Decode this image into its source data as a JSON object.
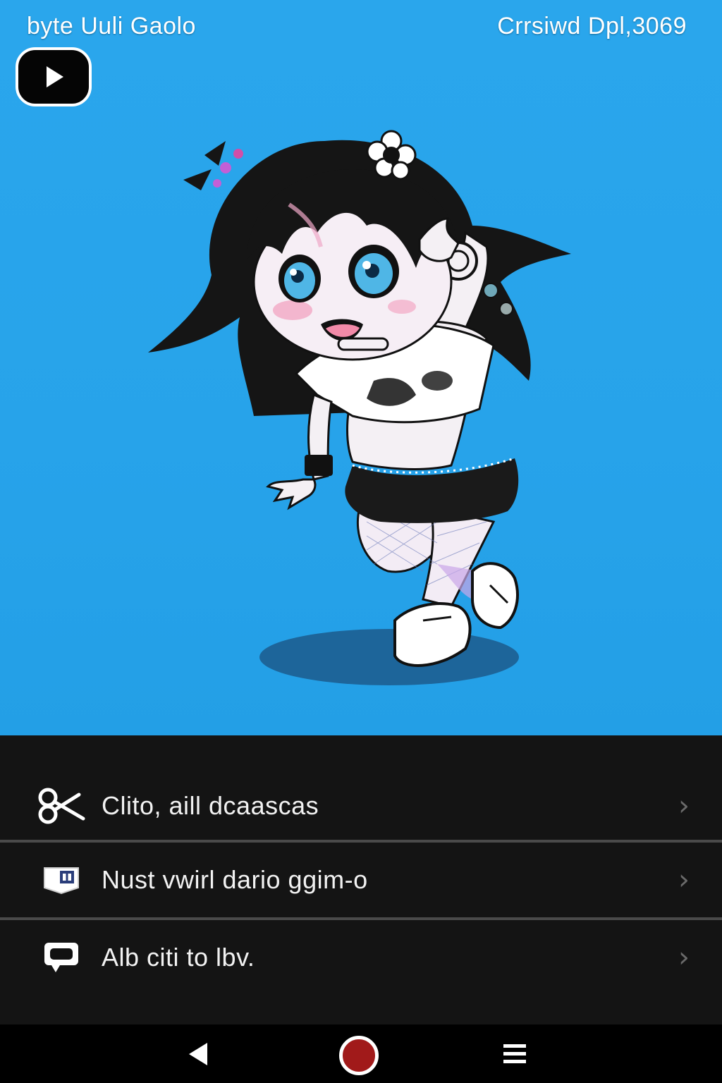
{
  "header": {
    "left_title": "byte Uuli Gaolo",
    "right_title": "Crrsiwd Dpl,3069"
  },
  "stage": {
    "background_color": "#27a3ea",
    "play_button_icon": "play-icon",
    "character": "chibi-goth-girl-illustration"
  },
  "menu": {
    "items": [
      {
        "label": "Clito, aill dcaascas",
        "icon": "scissors-icon"
      },
      {
        "label": "Nust vwirl dario ggim-o",
        "icon": "card-icon"
      },
      {
        "label": "Alb citi to lbv.",
        "icon": "chat-bubble-icon"
      }
    ],
    "chevron_icon": "chevron-right-icon"
  },
  "nav": {
    "back_icon": "back-triangle-icon",
    "home_icon": "home-record-icon",
    "menu_icon": "hamburger-icon",
    "home_color": "#a11a1a"
  }
}
